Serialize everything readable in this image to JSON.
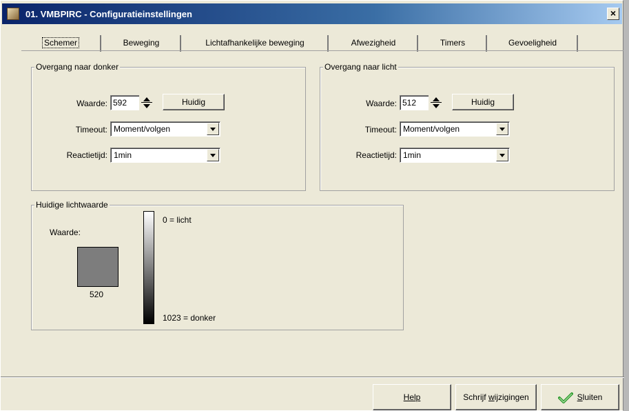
{
  "window": {
    "title": "01. VMBPIRC - Configuratieinstellingen",
    "close_label": "×"
  },
  "tabs": [
    {
      "label": "Schemer",
      "active": true
    },
    {
      "label": "Beweging"
    },
    {
      "label": "Lichtafhankelijke beweging"
    },
    {
      "label": "Afwezigheid"
    },
    {
      "label": "Timers"
    },
    {
      "label": "Gevoeligheid"
    }
  ],
  "dark_group": {
    "legend": "Overgang naar donker",
    "value_label": "Waarde:",
    "value": "592",
    "current_button": "Huidig",
    "timeout_label": "Timeout:",
    "timeout_value": "Moment/volgen",
    "reaction_label": "Reactietijd:",
    "reaction_value": "1min"
  },
  "light_group": {
    "legend": "Overgang naar licht",
    "value_label": "Waarde:",
    "value": "512",
    "current_button": "Huidig",
    "timeout_label": "Timeout:",
    "timeout_value": "Moment/volgen",
    "reaction_label": "Reactietijd:",
    "reaction_value": "1min"
  },
  "current_light": {
    "legend": "Huidige lichtwaarde",
    "value_label": "Waarde:",
    "value": "520",
    "swatch_color": "#7d7d7d",
    "scale_top": "0 = licht",
    "scale_bottom": "1023 = donker"
  },
  "footer": {
    "help_button": "Help",
    "write_button_pre": "Schrijf ",
    "write_button_u": "w",
    "write_button_post": "ijzigingen",
    "close_button_u": "S",
    "close_button_post": "luiten"
  },
  "colors": {
    "title_start": "#0a246a",
    "check": "#2e9a2e"
  }
}
